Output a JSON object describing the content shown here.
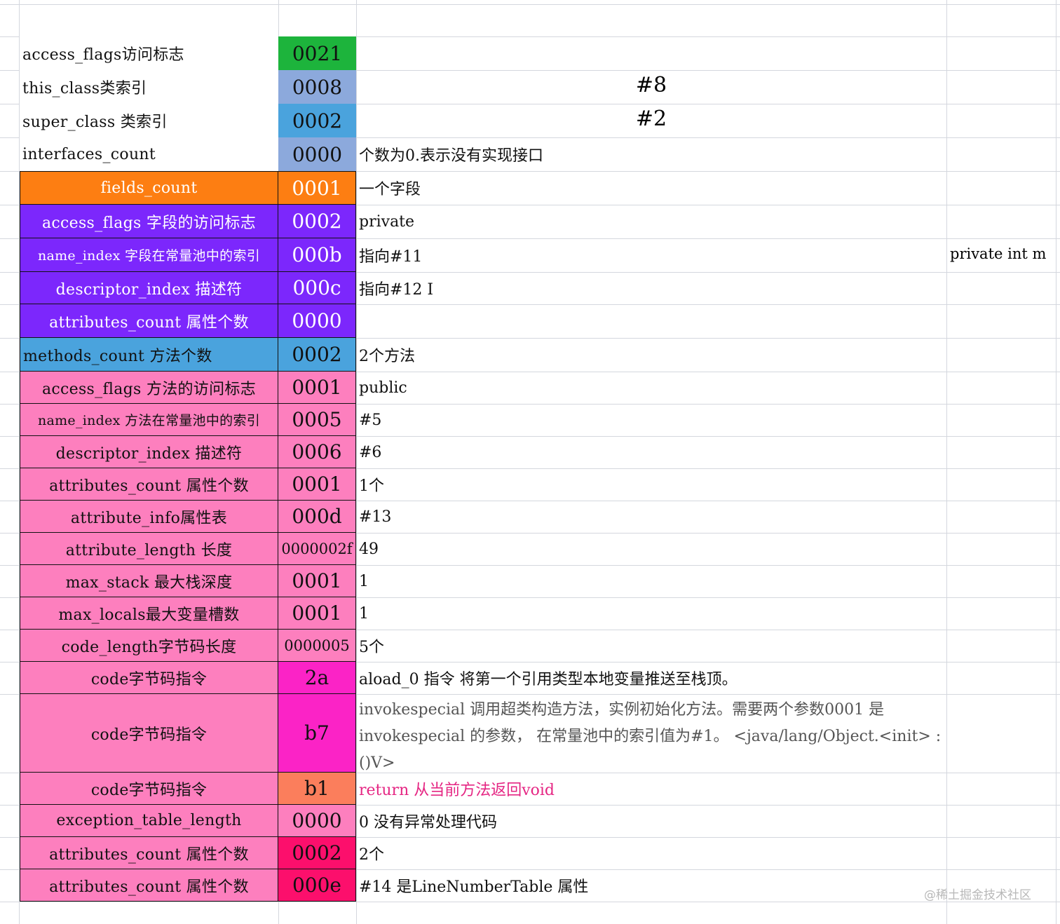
{
  "rows": [
    {
      "label": "access_flags访问标志",
      "hex": "0021",
      "desc": "",
      "label_bg": "#ffffff",
      "hex_bg": "#1db43c",
      "label_color": "#111111"
    },
    {
      "label": "this_class类索引",
      "hex": "0008",
      "desc": "",
      "label_bg": "#ffffff",
      "hex_bg": "#8ca9dc",
      "label_color": "#111111"
    },
    {
      "label": "super_class 类索引",
      "hex": "0002",
      "desc": "",
      "label_bg": "#ffffff",
      "hex_bg": "#4aa3dd",
      "label_color": "#111111"
    },
    {
      "label": "interfaces_count",
      "hex": "0000",
      "desc": "个数为0.表示没有实现接口",
      "label_bg": "#ffffff",
      "hex_bg": "#8ca9dc",
      "label_color": "#111111"
    },
    {
      "label": "fields_count",
      "hex": "0001",
      "desc": "一个字段",
      "label_bg": "#fd7e12",
      "hex_bg": "#fd7e12",
      "label_color": "#ffffff"
    },
    {
      "label": "access_flags 字段的访问标志",
      "hex": "0002",
      "desc": "private",
      "label_bg": "#7c27fc",
      "hex_bg": "#7c27fc",
      "label_color": "#ffffff"
    },
    {
      "label": "name_index 字段在常量池中的索引",
      "hex": "000b",
      "desc": "指向#11",
      "label_bg": "#7c27fc",
      "hex_bg": "#7c27fc",
      "label_color": "#ffffff"
    },
    {
      "label": "descriptor_index 描述符",
      "hex": "000c",
      "desc": "指向#12   I",
      "label_bg": "#7c27fc",
      "hex_bg": "#7c27fc",
      "label_color": "#ffffff"
    },
    {
      "label": "attributes_count 属性个数",
      "hex": "0000",
      "desc": "",
      "label_bg": "#7c27fc",
      "hex_bg": "#7c27fc",
      "label_color": "#ffffff"
    },
    {
      "label": "methods_count  方法个数",
      "hex": "0002",
      "desc": "2个方法",
      "label_bg": "#4aa3dd",
      "hex_bg": "#4aa3dd",
      "label_color": "#111111"
    },
    {
      "label": "access_flags 方法的访问标志",
      "hex": "0001",
      "desc": "public",
      "label_bg": "#fd7fbe",
      "hex_bg": "#fd7fbe",
      "label_color": "#111111"
    },
    {
      "label": "name_index 方法在常量池中的索引",
      "hex": "0005",
      "desc": "#5",
      "label_bg": "#fd7fbe",
      "hex_bg": "#fd7fbe",
      "label_color": "#111111"
    },
    {
      "label": "descriptor_index 描述符",
      "hex": "0006",
      "desc": "#6",
      "label_bg": "#fd7fbe",
      "hex_bg": "#fd7fbe",
      "label_color": "#111111"
    },
    {
      "label": "attributes_count 属性个数",
      "hex": "0001",
      "desc": "1个",
      "label_bg": "#fd7fbe",
      "hex_bg": "#fd7fbe",
      "label_color": "#111111"
    },
    {
      "label": "attribute_info属性表",
      "hex": "000d",
      "desc": "#13",
      "label_bg": "#fd7fbe",
      "hex_bg": "#fd7fbe",
      "label_color": "#111111"
    },
    {
      "label": "attribute_length 长度",
      "hex": "0000002f",
      "desc": "49",
      "label_bg": "#fd7fbe",
      "hex_bg": "#fd7fbe",
      "label_color": "#111111"
    },
    {
      "label": "max_stack 最大栈深度",
      "hex": "0001",
      "desc": "1",
      "label_bg": "#fd7fbe",
      "hex_bg": "#fd7fbe",
      "label_color": "#111111"
    },
    {
      "label": "max_locals最大变量槽数",
      "hex": "0001",
      "desc": "1",
      "label_bg": "#fd7fbe",
      "hex_bg": "#fd7fbe",
      "label_color": "#111111"
    },
    {
      "label": "code_length字节码长度",
      "hex": "0000005",
      "desc": "5个",
      "label_bg": "#fd7fbe",
      "hex_bg": "#fd7fbe",
      "label_color": "#111111"
    },
    {
      "label": "code字节码指令",
      "hex": "2a",
      "desc": "aload_0 指令 将第一个引用类型本地变量推送至栈顶。",
      "label_bg": "#fd7fbe",
      "hex_bg": "#fb23c6",
      "label_color": "#111111"
    },
    {
      "label": "code字节码指令",
      "hex": "b7",
      "desc": "invokespecial  调用超类构造方法，实例初始化方法。需要两个参数0001 是invokespecial 的参数，  在常量池中的索引值为#1。 <java/lang/Object.<init> : ()V>",
      "label_bg": "#fd7fbe",
      "hex_bg": "#fb23c6",
      "label_color": "#111111"
    },
    {
      "label": "code字节码指令",
      "hex": "b1",
      "desc": "return  从当前方法返回void",
      "label_bg": "#fd7fbe",
      "hex_bg": "#fb7e5c",
      "label_color": "#111111"
    },
    {
      "label": "exception_table_length",
      "hex": "0000",
      "desc": "0 没有异常处理代码",
      "label_bg": "#fd7fbe",
      "hex_bg": "#fd7fbe",
      "label_color": "#111111"
    },
    {
      "label": "attributes_count 属性个数",
      "hex": "0002",
      "desc": "2个",
      "label_bg": "#fd7fbe",
      "hex_bg": "#fc0f6c",
      "label_color": "#111111"
    },
    {
      "label": "attributes_count 属性个数",
      "hex": "000e",
      "desc": "#14    是LineNumberTable 属性",
      "label_bg": "#fd7fbe",
      "hex_bg": "#fc0f6c",
      "label_color": "#111111"
    }
  ],
  "this_class_ref": "#8",
  "super_class_ref": "#2",
  "field_note": "private int m",
  "watermark": "@稀土掘金技术社区"
}
